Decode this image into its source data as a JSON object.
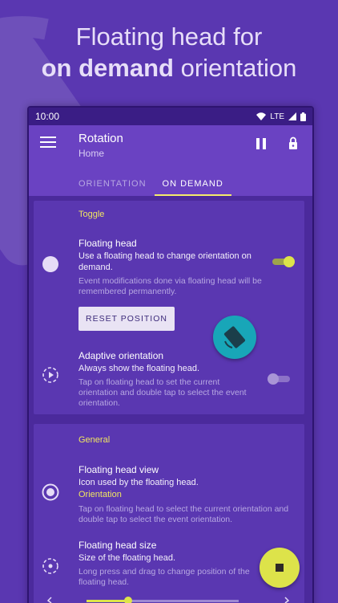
{
  "headline": {
    "line1": "Floating head for",
    "line2_bold": "on demand",
    "line2_rest": " orientation"
  },
  "status_bar": {
    "time": "10:00",
    "network": "LTE"
  },
  "app_bar": {
    "title": "Rotation",
    "subtitle": "Home",
    "icons": [
      "menu-icon",
      "pause-icon",
      "lock-icon"
    ]
  },
  "tabs": [
    {
      "label": "ORIENTATION",
      "active": false
    },
    {
      "label": "ON DEMAND",
      "active": true
    }
  ],
  "toggle_section": {
    "title": "Toggle",
    "floating_head": {
      "title": "Floating head",
      "subtitle": "Use a floating head to change orientation on demand.",
      "description": "Event modifications done via floating head will be remembered permanently.",
      "enabled": true,
      "reset_label": "RESET POSITION"
    },
    "adaptive_orientation": {
      "title": "Adaptive orientation",
      "subtitle": "Always show the floating head.",
      "description": "Tap on floating head to set the current orientation and double tap to select the event orientation.",
      "enabled": false
    }
  },
  "general_section": {
    "title": "General",
    "floating_head_view": {
      "title": "Floating head view",
      "subtitle": "Icon used by the floating head.",
      "value": "Orientation",
      "description": "Tap on floating head to select the current orientation and double tap to select the event orientation."
    },
    "floating_head_size": {
      "title": "Floating head size",
      "subtitle": "Size of the floating head.",
      "description": "Long press and drag to change position of the floating head."
    }
  },
  "colors": {
    "background": "#5a37b1",
    "app_bar": "#6a42c2",
    "accent": "#f0e661",
    "floating_head": "#18a6b8",
    "fab": "#dde34a"
  }
}
